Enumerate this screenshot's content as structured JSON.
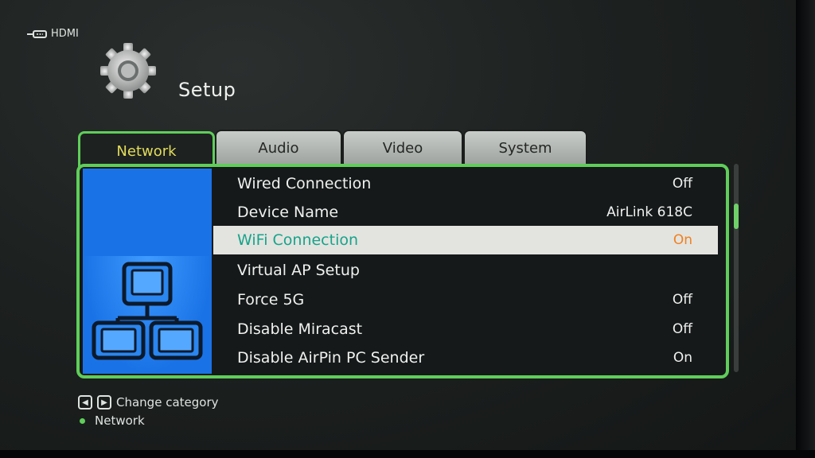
{
  "input_source": "HDMI",
  "title": "Setup",
  "tabs": [
    {
      "label": "Network",
      "active": true
    },
    {
      "label": "Audio",
      "active": false
    },
    {
      "label": "Video",
      "active": false
    },
    {
      "label": "System",
      "active": false
    }
  ],
  "settings": [
    {
      "label": "Wired Connection",
      "value": "Off",
      "selected": false
    },
    {
      "label": "Device Name",
      "value": "AirLink 618C",
      "selected": false
    },
    {
      "label": "WiFi Connection",
      "value": "On",
      "selected": true
    },
    {
      "label": "Virtual AP Setup",
      "value": "",
      "selected": false
    },
    {
      "label": "Force 5G",
      "value": "Off",
      "selected": false
    },
    {
      "label": "Disable Miracast",
      "value": "Off",
      "selected": false
    },
    {
      "label": "Disable AirPin PC Sender",
      "value": "On",
      "selected": false
    }
  ],
  "footer": {
    "hint": "Change category",
    "current_category": "Network"
  },
  "colors": {
    "accent_green": "#5fce5a",
    "active_tab_text": "#e2dc5a",
    "selected_label": "#18a38a",
    "selected_value": "#f08020",
    "side_panel_blue": "#1a73e6"
  },
  "icons": [
    "hdmi-input-icon",
    "gear-icon",
    "network-icon",
    "left-arrow-key-icon",
    "right-arrow-key-icon",
    "status-dot-icon"
  ]
}
